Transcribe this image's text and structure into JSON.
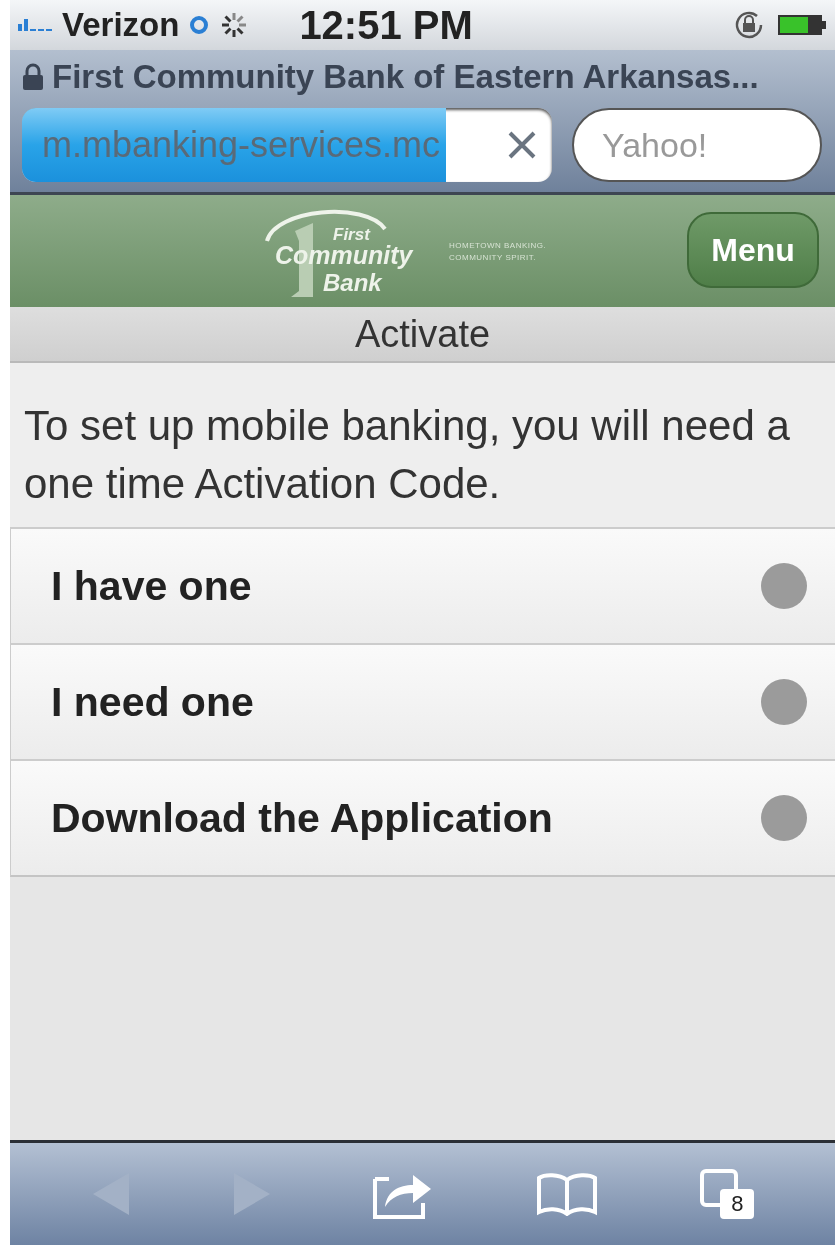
{
  "status_bar": {
    "carrier": "Verizon",
    "time": "12:51 PM"
  },
  "browser": {
    "page_title": "First Community Bank of Eastern Arkansas...",
    "url": "m.mbanking-services.mc",
    "load_progress": {
      "level": 0.8
    },
    "search": {
      "placeholder": "Yahoo!"
    },
    "tab_count": "8"
  },
  "header": {
    "logo": {
      "line_1": "First",
      "line_2": "Community",
      "line_3": "Bank",
      "tagline_1": "HOMETOWN BANKING.",
      "tagline_2": "COMMUNITY SPIRIT."
    },
    "menu_button": "Menu"
  },
  "page_title": "Activate",
  "intro": "To set up mobile banking, you will need a one time Activation Code.",
  "options": [
    {
      "label": "I have one"
    },
    {
      "label": "I need one"
    },
    {
      "label": "Download the Application"
    }
  ]
}
